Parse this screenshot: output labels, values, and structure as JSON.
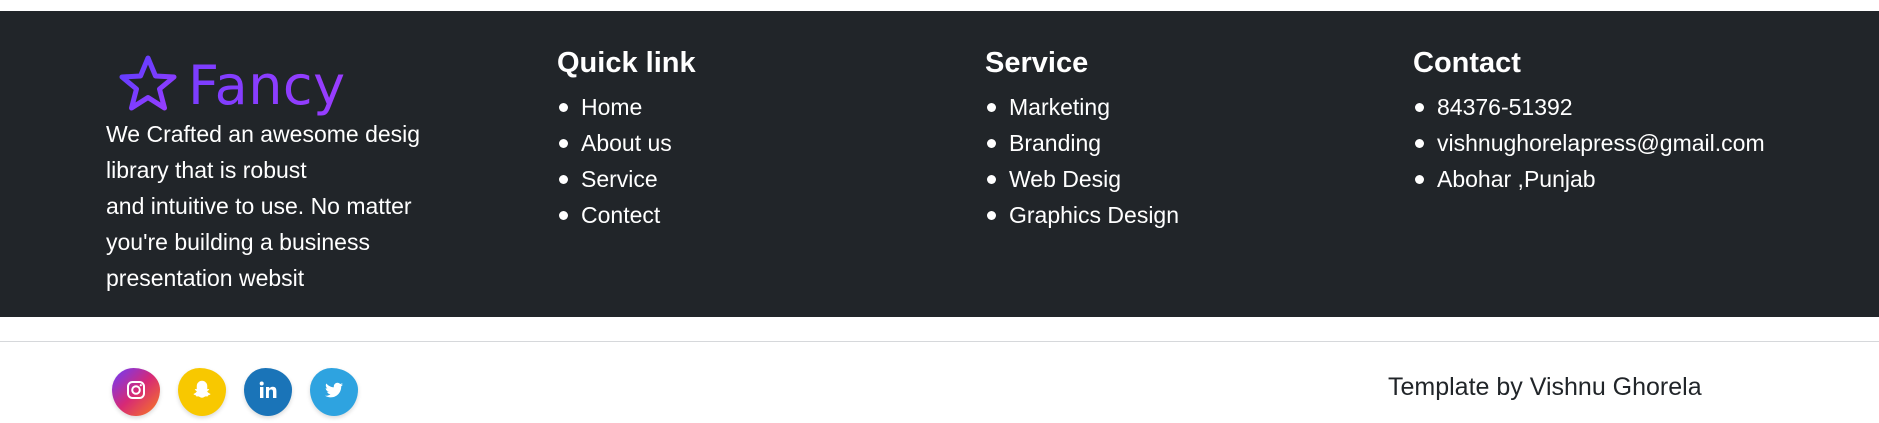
{
  "brand": {
    "name": "Fancy",
    "logo_icon": "star-outline-icon",
    "accent_color": "#7b3dff"
  },
  "about": {
    "lines": [
      "We Crafted an awesome desig",
      "library that is robust",
      "and intuitive to use. No matter",
      "you're building a business",
      "presentation websit"
    ]
  },
  "quick_links": {
    "title": "Quick link",
    "items": [
      "Home",
      "About us",
      "Service",
      "Contect"
    ]
  },
  "service": {
    "title": "Service",
    "items": [
      "Marketing",
      "Branding",
      "Web Desig",
      "Graphics Design"
    ]
  },
  "contact": {
    "title": "Contact",
    "items": [
      "84376-51392",
      "vishnughorelapress@gmail.com",
      "Abohar ,Punjab"
    ]
  },
  "social": [
    {
      "name": "instagram",
      "icon": "instagram-icon"
    },
    {
      "name": "snapchat",
      "icon": "snapchat-icon"
    },
    {
      "name": "linkedin",
      "icon": "linkedin-icon"
    },
    {
      "name": "twitter",
      "icon": "twitter-icon"
    }
  ],
  "credit": "Template by Vishnu Ghorela",
  "colors": {
    "footer_bg": "#212529",
    "text_light": "#ffffff",
    "divider": "#d6d8db"
  }
}
